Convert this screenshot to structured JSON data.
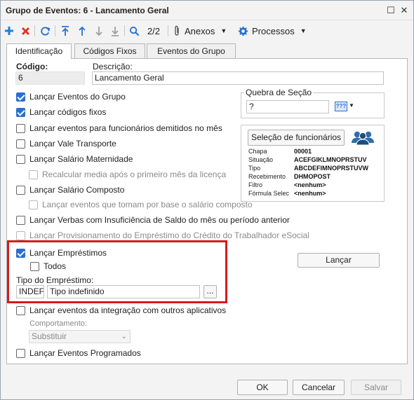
{
  "window": {
    "title": "Grupo de Eventos: 6 - Lancamento Geral",
    "restore_glyph": "☐",
    "close_glyph": "✕"
  },
  "toolbar": {
    "add_icon": "plus-icon",
    "delete_icon": "delete-x-icon",
    "refresh_icon": "refresh-icon",
    "first_icon": "first-record-icon",
    "prev_icon": "previous-record-icon",
    "next_icon": "next-record-icon",
    "last_icon": "last-record-icon",
    "search_icon": "search-icon",
    "record_position": "2/2",
    "attachments_label": "Anexos",
    "processes_label": "Processos",
    "dropdown_glyph": "▼"
  },
  "tabs": [
    {
      "label": "Identificação",
      "active": true
    },
    {
      "label": "Códigos Fixos",
      "active": false
    },
    {
      "label": "Eventos do Grupo",
      "active": false
    }
  ],
  "header": {
    "codigo_label": "Código:",
    "codigo_value": "6",
    "descricao_label": "Descrição:",
    "descricao_value": "Lancamento Geral"
  },
  "options": [
    {
      "label": "Lançar Eventos do Grupo",
      "checked": true,
      "disabled": false
    },
    {
      "label": "Lançar códigos fixos",
      "checked": true,
      "disabled": false
    },
    {
      "label": "Lançar eventos para funcionários demitidos no mês",
      "checked": false,
      "disabled": false
    },
    {
      "label": "Lançar Vale Transporte",
      "checked": false,
      "disabled": false
    },
    {
      "label": "Lançar Salário Maternidade",
      "checked": false,
      "disabled": false
    },
    {
      "label": "Recalcular media após o primeiro mês da licença",
      "checked": false,
      "disabled": true
    },
    {
      "label": "Lançar Salário Composto",
      "checked": false,
      "disabled": false
    },
    {
      "label": "Lançar eventos que tomam por base o salário composto",
      "checked": false,
      "disabled": true
    },
    {
      "label": "Lançar Verbas com Insuficiência de Saldo do mês ou período anterior",
      "checked": false,
      "disabled": false
    },
    {
      "label": "Lançar Provisionamento do Empréstimo do Crédito do Trabalhador eSocial",
      "checked": false,
      "disabled": true
    }
  ],
  "emprestimos": {
    "label": "Lançar Empréstimos",
    "checked": true,
    "todos_label": "Todos",
    "todos_checked": false,
    "tipo_label": "Tipo do Empréstimo:",
    "tipo_code": "INDEF",
    "tipo_desc": "Tipo indefinido",
    "lookup_button": "..."
  },
  "integracao": {
    "label": "Lançar eventos da integração com outros aplicativos",
    "checked": false,
    "comportamento_label": "Comportamento:",
    "comportamento_value": "Substituir"
  },
  "programados": {
    "label": "Lançar Eventos Programados",
    "checked": false
  },
  "quebra": {
    "label": "Quebra de Seção",
    "value": "?",
    "picker_text": "???"
  },
  "selecao": {
    "button_label": "Seleção de funcionários",
    "rows": [
      {
        "key": "Chapa",
        "value": "00001"
      },
      {
        "key": "Situação",
        "value": "ACEFGIKLMNOPRSTUV"
      },
      {
        "key": "Tipo",
        "value": "ABCDEFIMNOPRSTUVW"
      },
      {
        "key": "Recebimento",
        "value": "DHMOPOST"
      },
      {
        "key": "Filtro",
        "value": "<nenhum>"
      },
      {
        "key": "Fórmula Selec",
        "value": "<nenhum>"
      }
    ]
  },
  "lancar_button": "Lançar",
  "footer": {
    "ok": "OK",
    "cancel": "Cancelar",
    "save": "Salvar"
  },
  "colors": {
    "accent": "#2a6fcf",
    "highlight": "#d21d1d",
    "add": "#1f7fd6",
    "delete": "#d23b2c"
  }
}
